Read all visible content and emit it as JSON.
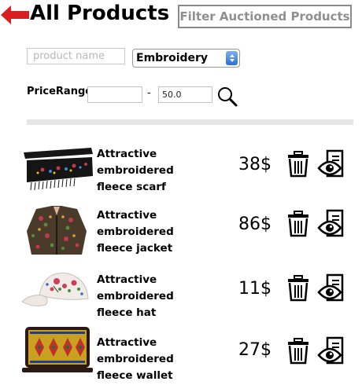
{
  "header": {
    "title": "All Products",
    "filter_button": "Filter Auctioned Products"
  },
  "filters": {
    "name_placeholder": "product name",
    "category_selected": "Embroidery",
    "price_label": "PriceRange",
    "price_min": "",
    "price_max": "50.0",
    "price_separator": "-"
  },
  "products": [
    {
      "name_line1": "Attractive embroidered",
      "name_line2": "fleece scarf",
      "price": "38$",
      "image": "scarf"
    },
    {
      "name_line1": "Attractive embroidered",
      "name_line2": "fleece jacket",
      "price": "86$",
      "image": "jacket"
    },
    {
      "name_line1": "Attractive embroidered",
      "name_line2": "fleece hat",
      "price": "11$",
      "image": "hat"
    },
    {
      "name_line1": "Attractive embroidered",
      "name_line2": "fleece wallet",
      "price": "27$",
      "image": "wallet"
    }
  ],
  "colors": {
    "back_arrow": "#d81e1e",
    "select_accent": "#2a70d6",
    "divider": "#e6e6e6"
  },
  "icons": [
    "back-arrow-icon",
    "search-icon",
    "trash-icon",
    "view-document-icon"
  ]
}
